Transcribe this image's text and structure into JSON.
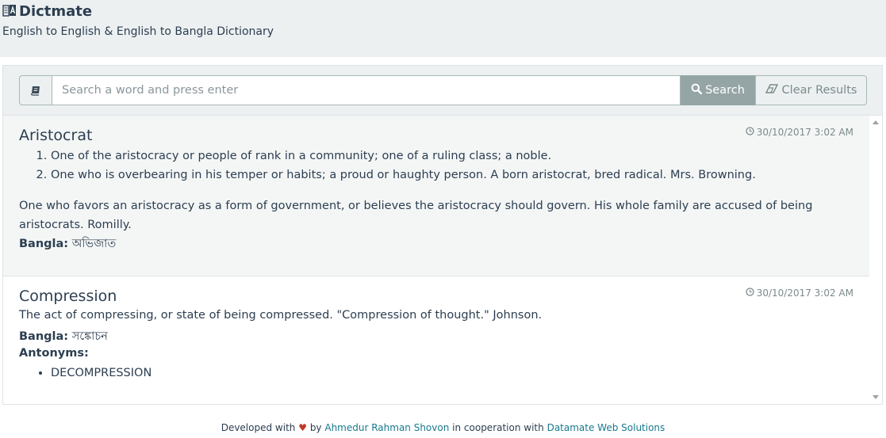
{
  "app": {
    "title": "Dictmate",
    "subtitle": "English to English & English to Bangla Dictionary"
  },
  "search": {
    "placeholder": "Search a word and press enter",
    "value": "",
    "search_label": "Search",
    "clear_label": "Clear Results"
  },
  "results": [
    {
      "word": "Aristocrat",
      "timestamp": "30/10/2017 3:02 AM",
      "definitions": [
        "One of the aristocracy or people of rank in a community; one of a ruling class; a noble.",
        "One who is overbearing in his temper or habits; a proud or haughty person. A born aristocrat, bred radical. Mrs. Browning."
      ],
      "extra": "One who favors an aristocracy as a form of government, or believes the aristocracy should govern. His whole family are accused of being aristocrats. Romilly.",
      "bangla_label": "Bangla:",
      "bangla": "অভিজাত"
    },
    {
      "word": "Compression",
      "timestamp": "30/10/2017 3:02 AM",
      "definition": "The act of compressing, or state of being compressed. \"Compression of thought.\" Johnson.",
      "bangla_label": "Bangla:",
      "bangla": "সঙ্কোচন",
      "antonyms_label": "Antonyms:",
      "antonyms": [
        "DECOMPRESSION"
      ]
    }
  ],
  "footer": {
    "prefix": "Developed with",
    "heart": "♥",
    "by": "by",
    "author": "Ahmedur Rahman Shovon",
    "middle": "in cooperation with",
    "company": "Datamate Web Solutions"
  },
  "colors": {
    "header_bg": "#ecf0f1",
    "search_button_bg": "#95a5a6",
    "link": "#18798c",
    "heart": "#c0392b"
  },
  "icons": {
    "logo": "dictionary-logo-icon",
    "book": "book-icon",
    "search": "search-icon",
    "eraser": "eraser-icon",
    "clock": "clock-icon"
  }
}
